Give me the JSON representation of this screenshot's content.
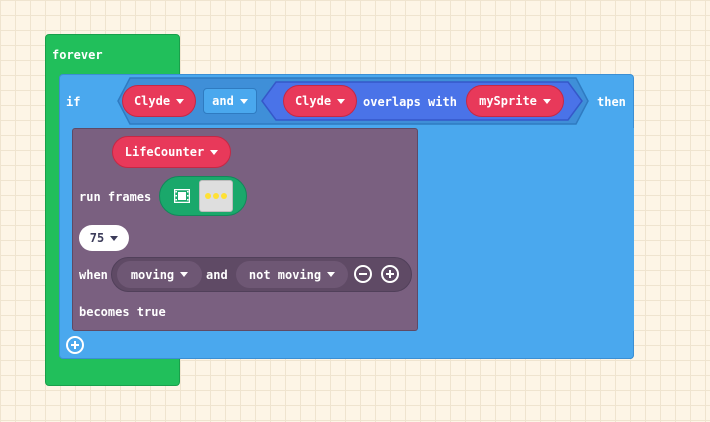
{
  "forever": {
    "label": "forever"
  },
  "if_block": {
    "if_label": "if",
    "then_label": "then",
    "operand_left": "Clyde",
    "operator": "and",
    "overlaps": {
      "sprite_a": "Clyde",
      "label": "overlaps with",
      "sprite_b": "mySprite"
    }
  },
  "event_block": {
    "sprite": "LifeCounter",
    "run_frames_label": "run frames",
    "animation_preview": "filmstrip",
    "interval": "75",
    "when_label": "when",
    "state_a": "moving",
    "and_label": "and",
    "state_b": "not moving",
    "becomes_label": "becomes true"
  },
  "colors": {
    "forever_green": "#21bf5b",
    "logic_blue": "#4aa8ee",
    "sprite_red": "#e8395a",
    "event_purple": "#7a6080",
    "animation_green": "#1aa86b",
    "background": "#fdf5e6"
  }
}
